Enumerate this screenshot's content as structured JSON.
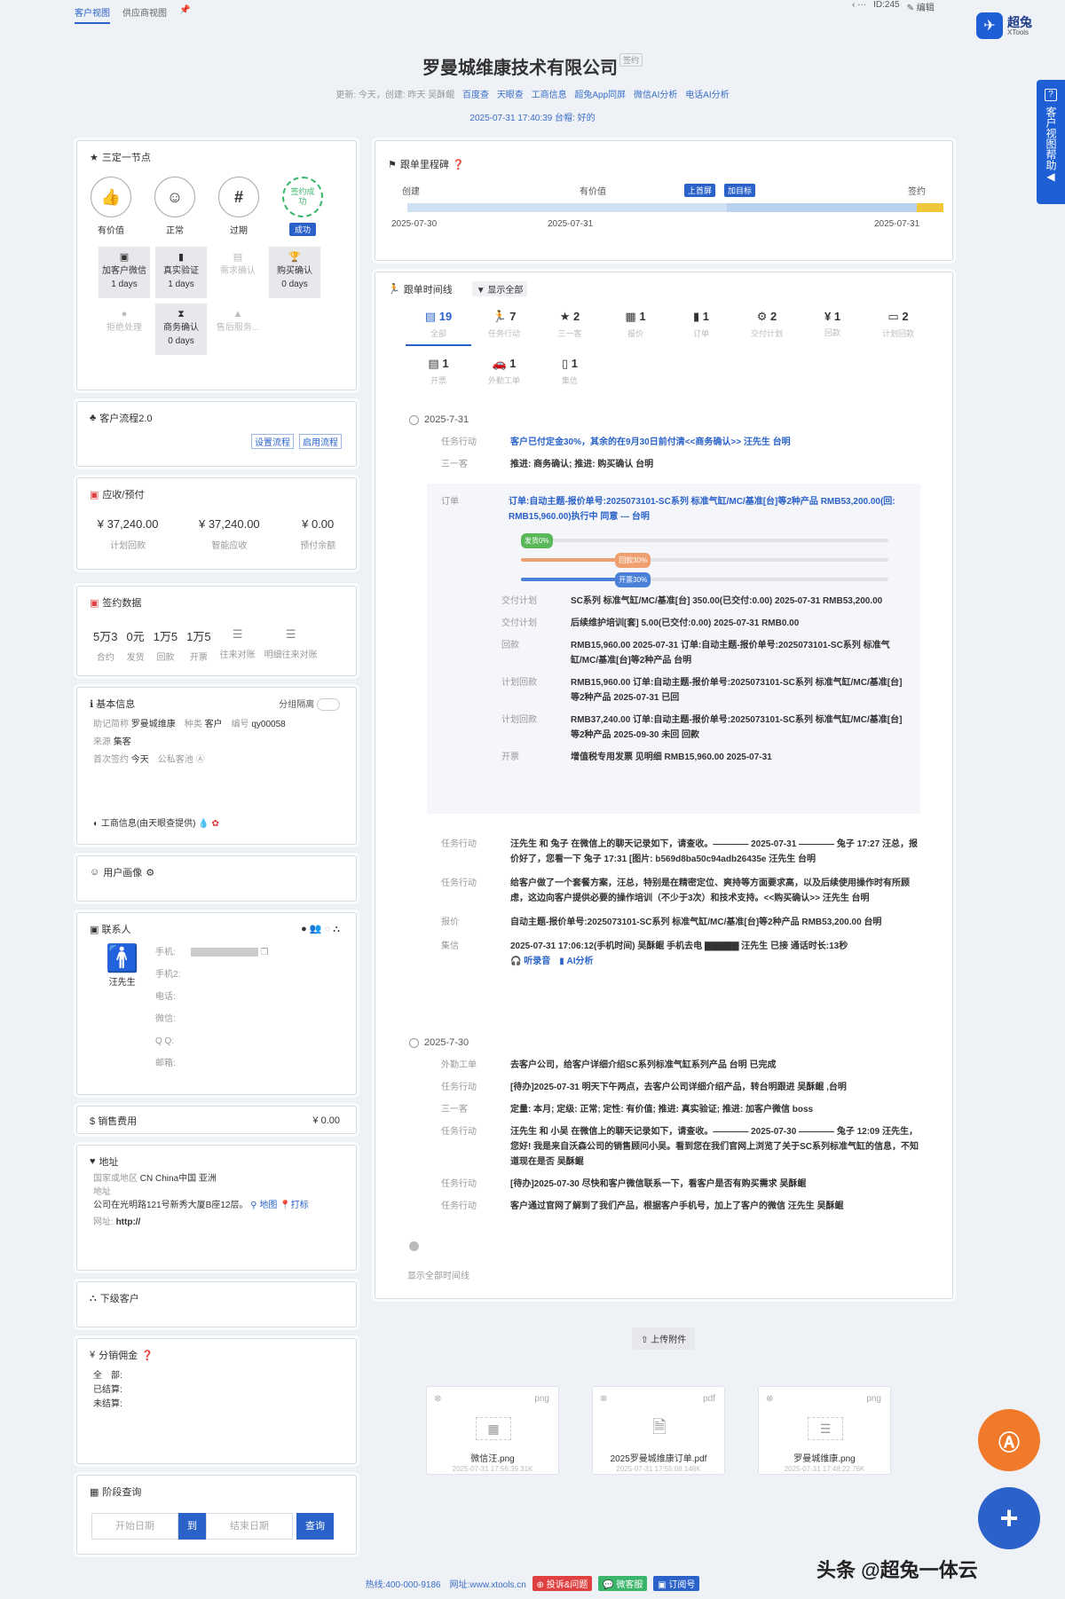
{
  "tabs": [
    "客户视图",
    "供应商视图"
  ],
  "top_right": {
    "id": "ID:245",
    "edit": "编辑"
  },
  "logo": {
    "name": "超兔",
    "sub": "XTools"
  },
  "company": {
    "name": "罗曼城维康技术有限公司",
    "tag": "签约"
  },
  "meta": {
    "prefix": "更新: 今天，创建: 昨天 吴酥鲲",
    "links": [
      "百度查",
      "天眼查",
      "工商信息",
      "超兔App同屏",
      "微信AI分析",
      "电话AI分析"
    ],
    "line2": "2025-07-31 17:40:39 台帽: 好的"
  },
  "help": {
    "text": "客户视图帮助",
    "q": "?"
  },
  "three_steps": {
    "title": "三定一节点",
    "nodes": [
      {
        "label": "有价值",
        "icon": "👍"
      },
      {
        "label": "正常",
        "icon": "☺"
      },
      {
        "label": "过期",
        "icon": "#"
      },
      {
        "label": "签约成功",
        "badge": "成功"
      }
    ],
    "steps": [
      {
        "name": "加客户微信",
        "days": "1 days",
        "active": true
      },
      {
        "name": "真实验证",
        "days": "1 days",
        "active": true
      },
      {
        "name": "需求确认",
        "days": "",
        "active": false
      },
      {
        "name": "购买确认",
        "days": "0 days",
        "active": true
      },
      {
        "name": "拒绝处理",
        "days": "",
        "active": false
      },
      {
        "name": "商务确认",
        "days": "0 days",
        "active": true
      },
      {
        "name": "售后服务...",
        "days": "",
        "active": false
      }
    ]
  },
  "flow": {
    "title": "客户流程2.0",
    "btn1": "设置流程",
    "btn2": "启用流程"
  },
  "receivable": {
    "title": "应收/预付",
    "items": [
      {
        "value": "¥ 37,240.00",
        "label": "计划回款"
      },
      {
        "value": "¥ 37,240.00",
        "label": "智能应收"
      },
      {
        "value": "¥ 0.00",
        "label": "预付余额"
      }
    ]
  },
  "sign_data": {
    "title": "签约数据",
    "items": [
      {
        "value": "5万3",
        "label": "合约"
      },
      {
        "value": "0元",
        "label": "发货"
      },
      {
        "value": "1万5",
        "label": "回款"
      },
      {
        "value": "1万5",
        "label": "开票"
      },
      {
        "value": "☰",
        "label": "往来对账"
      },
      {
        "value": "☰",
        "label": "明细往来对账"
      }
    ]
  },
  "basic": {
    "title": "基本信息",
    "group": "分组隔离",
    "short_label": "助记简称",
    "short": "罗曼城维康",
    "kind_label": "种类",
    "kind": "客户",
    "code_label": "编号",
    "code": "qy00058",
    "source_label": "来源",
    "source": "集客",
    "first_label": "首次签约",
    "first": "今天",
    "pool": "公私客池",
    "biz": "工商信息(由天眼查提供)"
  },
  "portrait": {
    "title": "用户画像"
  },
  "contact": {
    "title": "联系人",
    "name": "汪先生",
    "fields": [
      "手机:",
      "手机2:",
      "电话:",
      "微信:",
      "Q Q:",
      "邮箱:"
    ]
  },
  "sales_fee": {
    "title": "销售费用",
    "value": "¥ 0.00"
  },
  "address": {
    "title": "地址",
    "region_label": "国家或地区",
    "region": "CN China中国 亚洲",
    "addr_label": "地址",
    "addr": "公司在光明路121号新秀大厦B座12层。",
    "map": "地图",
    "mark": "打标",
    "web_label": "网址:",
    "web": "http://"
  },
  "sub_customers": {
    "title": "下级客户"
  },
  "commission": {
    "title": "分销佣金",
    "rows": [
      "全　部:",
      "已结算:",
      "未结算:"
    ]
  },
  "stage_query": {
    "title": "阶段查询",
    "start": "开始日期",
    "to": "到",
    "end": "结束日期",
    "btn": "查询"
  },
  "milestone": {
    "title": "跟单里程碑",
    "stages": [
      "创建",
      "有价值",
      "签约"
    ],
    "tags": [
      "上首屏",
      "加目标"
    ],
    "dates": [
      "2025-07-30",
      "2025-07-31",
      "2025-07-31"
    ]
  },
  "timeline": {
    "title": "跟单时间线",
    "toggle": "显示全部",
    "cats": [
      {
        "num": "19",
        "cap": "全部",
        "icon": "▤"
      },
      {
        "num": "7",
        "cap": "任务行动",
        "icon": "🏃"
      },
      {
        "num": "2",
        "cap": "三一客",
        "icon": "★"
      },
      {
        "num": "1",
        "cap": "报价",
        "icon": "▦"
      },
      {
        "num": "1",
        "cap": "订单",
        "icon": "▮"
      },
      {
        "num": "2",
        "cap": "交付计划",
        "icon": "⚙"
      },
      {
        "num": "1",
        "cap": "回款",
        "icon": "¥"
      },
      {
        "num": "2",
        "cap": "计划回款",
        "icon": "▭"
      },
      {
        "num": "1",
        "cap": "开票",
        "icon": "▤"
      },
      {
        "num": "1",
        "cap": "外勤工单",
        "icon": "🚗"
      },
      {
        "num": "1",
        "cap": "集信",
        "icon": "▯"
      }
    ],
    "d1": "2025-7-31",
    "d2": "2025-7-30",
    "show_all": "显示全部时间线",
    "e1": {
      "label": "任务行动",
      "text": "客户已付定金30%，其余的在9月30日前付清<<商务确认>> 汪先生 台明"
    },
    "e2": {
      "label": "三一客",
      "text": "推进: 商务确认; 推进: 购买确认 台明"
    },
    "order": {
      "label": "订单",
      "text": "订单:自动主题-报价单号:2025073101-SC系列 标准气缸/MC/基准[台]等2种产品 RMB53,200.00(回: RMB15,960.00)执行中 同意 --- 台明",
      "bars": [
        {
          "text": "发货0%",
          "pct": 0.05,
          "color": "#5ab85a"
        },
        {
          "text": "回款30%",
          "pct": 0.3,
          "color": "#f0a070"
        },
        {
          "text": "开票30%",
          "pct": 0.3,
          "color": "#4a80d8"
        }
      ],
      "subs": [
        {
          "label": "交付计划",
          "text": "SC系列 标准气缸/MC/基准[台] 350.00(已交付:0.00) 2025-07-31 RMB53,200.00"
        },
        {
          "label": "交付计划",
          "text": "后续维护培训[套] 5.00(已交付:0.00) 2025-07-31 RMB0.00"
        },
        {
          "label": "回款",
          "text": "RMB15,960.00 2025-07-31 订单:自动主题-报价单号:2025073101-SC系列 标准气缸/MC/基准[台]等2种产品 台明"
        },
        {
          "label": "计划回款",
          "text": "RMB15,960.00 订单:自动主题-报价单号:2025073101-SC系列 标准气缸/MC/基准[台]等2种产品 2025-07-31 已回"
        },
        {
          "label": "计划回款",
          "text": "RMB37,240.00 订单:自动主题-报价单号:2025073101-SC系列 标准气缸/MC/基准[台]等2种产品 2025-09-30 未回 回款"
        },
        {
          "label": "开票",
          "text": "增值税专用发票 见明细 RMB15,960.00 2025-07-31"
        }
      ]
    },
    "e3": {
      "label": "任务行动",
      "text": "汪先生 和 兔子 在微信上的聊天记录如下，请查收。———— 2025-07-31 ———— 兔子 17:27 汪总，报价好了，您看一下 兔子 17:31 [图片: b569d8ba50c94adb26435e 汪先生 台明"
    },
    "e4": {
      "label": "任务行动",
      "text": "给客户做了一个套餐方案，汪总，特别是在精密定位、爽持等方面要求高，以及后续使用操作时有所顾虑，这边向客户提供必要的操作培训（不少于3次）和技术支持。<<购买确认>> 汪先生 台明"
    },
    "e5": {
      "label": "报价",
      "text": "自动主题-报价单号:2025073101-SC系列 标准气缸/MC/基准[台]等2种产品 RMB53,200.00 台明"
    },
    "e6": {
      "label": "集信",
      "text": "2025-07-31 17:06:12(手机时间) 吴酥鲲 手机去电 ▇▇▇▇▇ 汪先生 已接 通话时长:13秒",
      "rec": "听录音",
      "ai": "AI分析"
    },
    "f1": {
      "label": "外勤工单",
      "text": "去客户公司，给客户详细介绍SC系列标准气缸系列产品 台明 已完成"
    },
    "f2": {
      "label": "任务行动",
      "text": "[待办]2025-07-31 明天下午两点，去客户公司详细介绍产品，转台明跟进 吴酥鲲 ,台明"
    },
    "f3": {
      "label": "三一客",
      "text": "定量: 本月; 定级: 正常; 定性: 有价值; 推进: 真实验证; 推进: 加客户微信 boss"
    },
    "f4": {
      "label": "任务行动",
      "text": "汪先生 和 小吴 在微信上的聊天记录如下，请查收。———— 2025-07-30 ———— 兔子 12:09 汪先生，您好! 我是来自沃森公司的销售顾问小吴。看到您在我们官网上浏览了关于SC系列标准气缸的信息，不知道现在是否 吴酥鲲"
    },
    "f5": {
      "label": "任务行动",
      "text": "[待办]2025-07-30 尽快和客户微信联系一下，看客户是否有购买需求 吴酥鲲"
    },
    "f6": {
      "label": "任务行动",
      "text": "客户通过官网了解到了我们产品，根据客户手机号，加上了客户的微信 汪先生 吴酥鲲"
    }
  },
  "upload": "上传附件",
  "attachments": [
    {
      "type": "png",
      "name": "微信汪.png",
      "info": "2025-07-31 17:56:39 31K"
    },
    {
      "type": "pdf",
      "name": "2025罗曼城维康订单.pdf",
      "info": "2025-07-31 17:55:08 148K"
    },
    {
      "type": "png",
      "name": "罗曼城维康.png",
      "info": "2025-07-31 17:48:22 76K"
    }
  ],
  "footer": {
    "hotline": "热线:400-000-9186",
    "site": "网址:www.xtools.cn",
    "tags": [
      "投诉&问题",
      "微客服",
      "订阅号"
    ]
  },
  "watermark": "头条 @超兔一体云",
  "colors": {
    "accent": "#2a62c9",
    "fab_orange": "#f07a2a",
    "fab_blue": "#2a62c9"
  }
}
